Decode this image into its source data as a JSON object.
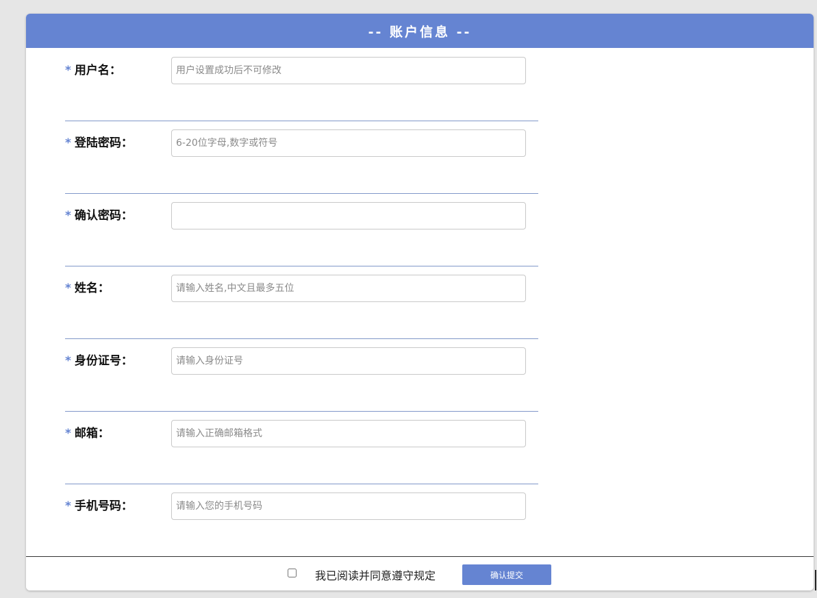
{
  "header": {
    "title": "-- 账户信息 --"
  },
  "form": {
    "required_mark": "*",
    "fields": [
      {
        "label": "用户名：",
        "value": "",
        "placeholder": "用户设置成功后不可修改"
      },
      {
        "label": "登陆密码：",
        "value": "",
        "placeholder": "6-20位字母,数字或符号"
      },
      {
        "label": "确认密码：",
        "value": "",
        "placeholder": ""
      },
      {
        "label": "姓名：",
        "value": "",
        "placeholder": "请输入姓名,中文且最多五位"
      },
      {
        "label": "身份证号：",
        "value": "",
        "placeholder": "请输入身份证号"
      },
      {
        "label": "邮箱：",
        "value": "",
        "placeholder": "请输入正确邮箱格式"
      },
      {
        "label": "手机号码：",
        "value": "",
        "placeholder": "请输入您的手机号码"
      }
    ]
  },
  "footer": {
    "agree_label": "我已阅读并同意遵守规定",
    "agree_checked": false,
    "submit_label": "确认提交"
  },
  "colors": {
    "accent": "#6584d2",
    "background": "#e6e6e6",
    "divider": "#7f96c8"
  }
}
